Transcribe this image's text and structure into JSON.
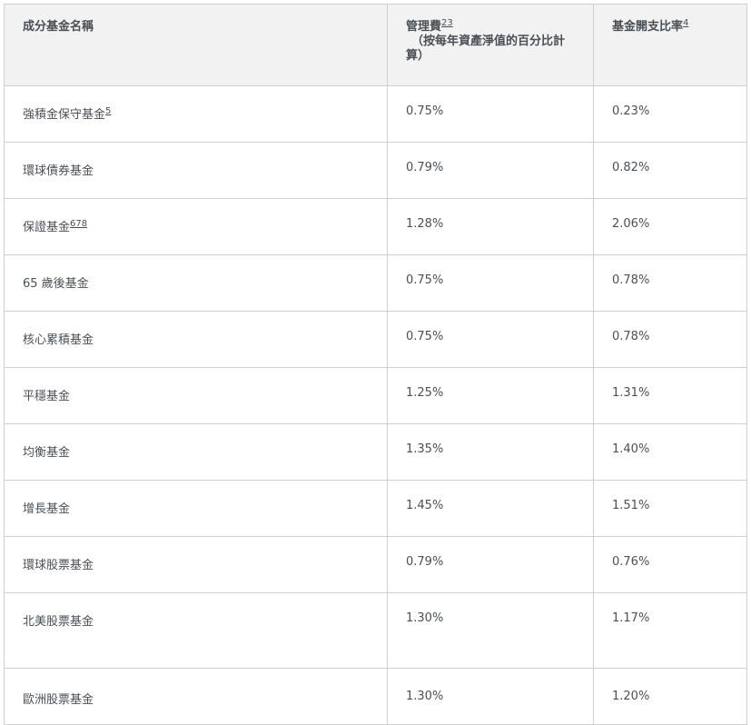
{
  "header": {
    "fund_name": "成分基金名稱",
    "management_fee": "管理費",
    "management_fee_sup": "23",
    "management_fee_note_1": "（按每年資產淨值的百分比計",
    "management_fee_note_2": "算）",
    "expense_ratio": "基金開支比率",
    "expense_ratio_sup": "4"
  },
  "rows": [
    {
      "name": "強積金保守基金",
      "sup": "5",
      "fee": "0.75%",
      "ratio": "0.23%"
    },
    {
      "name": "環球債券基金",
      "sup": "",
      "fee": "0.79%",
      "ratio": "0.82%"
    },
    {
      "name": "保證基金",
      "sup": "678",
      "fee": "1.28%",
      "ratio": "2.06%"
    },
    {
      "name": "65 歲後基金",
      "sup": "",
      "fee": "0.75%",
      "ratio": "0.78%"
    },
    {
      "name": "核心累積基金",
      "sup": "",
      "fee": "0.75%",
      "ratio": "0.78%"
    },
    {
      "name": "平穩基金",
      "sup": "",
      "fee": "1.25%",
      "ratio": "1.31%"
    },
    {
      "name": "均衡基金",
      "sup": "",
      "fee": "1.35%",
      "ratio": "1.40%"
    },
    {
      "name": "增長基金",
      "sup": "",
      "fee": "1.45%",
      "ratio": "1.51%"
    },
    {
      "name": "環球股票基金",
      "sup": "",
      "fee": "0.79%",
      "ratio": "0.76%"
    },
    {
      "name": "北美股票基金",
      "sup": "",
      "fee": "1.30%",
      "ratio": "1.17%"
    },
    {
      "name": "歐洲股票基金",
      "sup": "",
      "fee": "1.30%",
      "ratio": "1.20%"
    }
  ]
}
